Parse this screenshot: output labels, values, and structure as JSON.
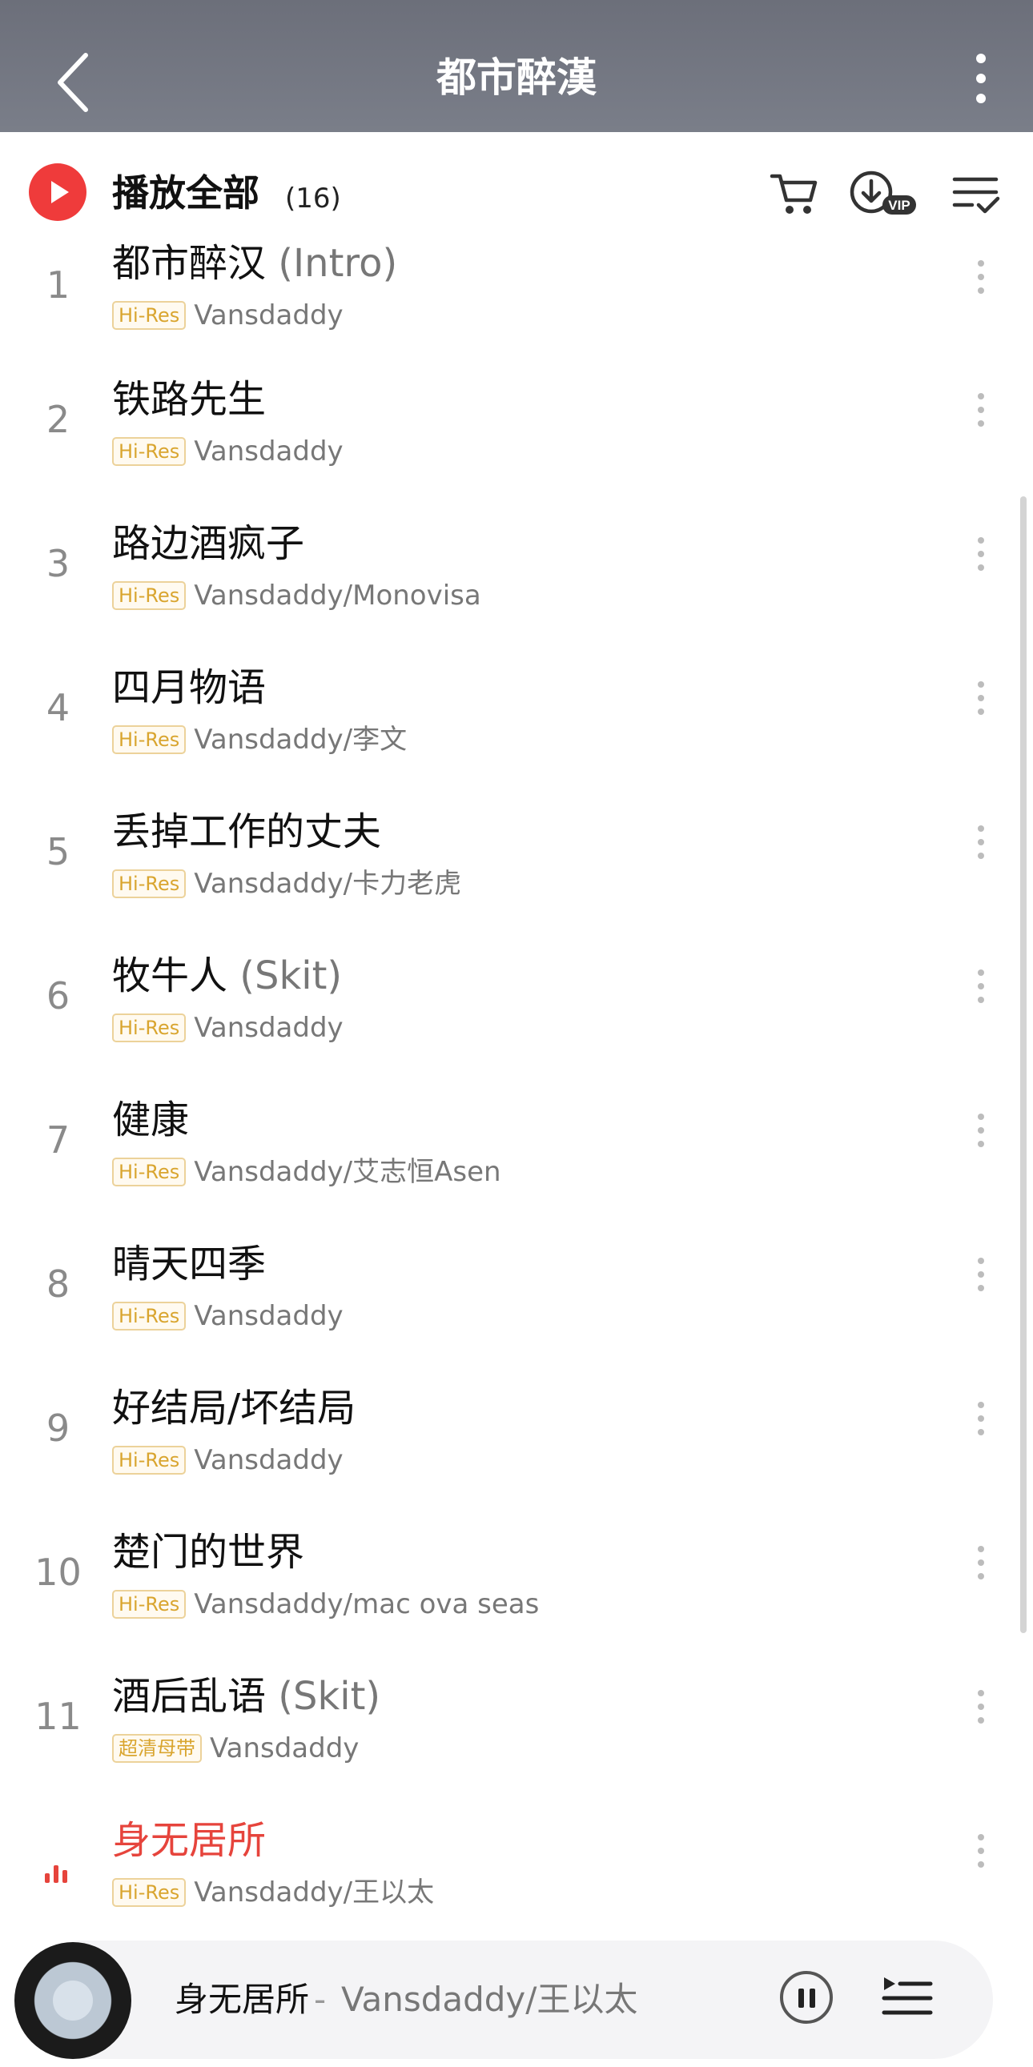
{
  "header": {
    "title": "都市醉漢",
    "back_icon": "chevron-left-icon",
    "more_icon": "more-vertical-icon"
  },
  "play_all": {
    "label": "播放全部",
    "count": "(16)",
    "icons": [
      "play-circle-icon",
      "cart-icon",
      "download-vip-icon",
      "multi-select-icon"
    ],
    "vip_text": "VIP",
    "accent": "#ef3b3b"
  },
  "songs": [
    {
      "num": "1",
      "title": "都市醉汉",
      "suffix": " (Intro)",
      "badge": "Hi-Res",
      "artist": "Vansdaddy"
    },
    {
      "num": "2",
      "title": "铁路先生",
      "suffix": "",
      "badge": "Hi-Res",
      "artist": "Vansdaddy"
    },
    {
      "num": "3",
      "title": "路边酒疯子",
      "suffix": "",
      "badge": "Hi-Res",
      "artist": "Vansdaddy/Monovisa"
    },
    {
      "num": "4",
      "title": "四月物语",
      "suffix": "",
      "badge": "Hi-Res",
      "artist": "Vansdaddy/李文"
    },
    {
      "num": "5",
      "title": "丢掉工作的丈夫",
      "suffix": "",
      "badge": "Hi-Res",
      "artist": "Vansdaddy/卡力老虎"
    },
    {
      "num": "6",
      "title": "牧牛人",
      "suffix": " (Skit)",
      "badge": "Hi-Res",
      "artist": "Vansdaddy"
    },
    {
      "num": "7",
      "title": "健康",
      "suffix": "",
      "badge": "Hi-Res",
      "artist": "Vansdaddy/艾志恒Asen"
    },
    {
      "num": "8",
      "title": "晴天四季",
      "suffix": "",
      "badge": "Hi-Res",
      "artist": "Vansdaddy"
    },
    {
      "num": "9",
      "title": "好结局/坏结局",
      "suffix": "",
      "badge": "Hi-Res",
      "artist": "Vansdaddy"
    },
    {
      "num": "10",
      "title": "楚门的世界",
      "suffix": "",
      "badge": "Hi-Res",
      "artist": "Vansdaddy/mac ova seas"
    },
    {
      "num": "11",
      "title": "酒后乱语",
      "suffix": " (Skit)",
      "badge": "超清母带",
      "artist": "Vansdaddy"
    },
    {
      "num": "",
      "title": "身无居所",
      "suffix": "",
      "badge": "Hi-Res",
      "artist": "Vansdaddy/王以太",
      "playing": true
    }
  ],
  "now_playing": {
    "title": "身无居所",
    "separator": "-",
    "artist": "Vansdaddy/王以太",
    "pause_icon": "pause-icon",
    "queue_icon": "playlist-queue-icon"
  },
  "colors": {
    "header_bg": "#72757f",
    "playing_red": "#e6443c",
    "badge_gold": "#d9a52f"
  }
}
